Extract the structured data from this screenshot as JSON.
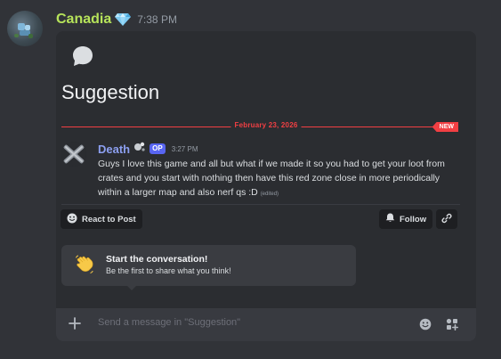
{
  "message": {
    "author": "Canadia",
    "timestamp": "7:38 PM",
    "badge_icon": "gem-icon",
    "author_color": "#b6e35a"
  },
  "thread": {
    "icon": "speech-bubble-icon",
    "title": "Suggestion",
    "divider_date": "February 23, 2026",
    "new_badge": "NEW",
    "accent": "#f23f43"
  },
  "post": {
    "author": "Death",
    "op_tag": "OP",
    "time": "3:27 PM",
    "body": "Guys I love this game and all but what if we made it so you had to get your loot from crates and you start with nothing then have this red zone close in more periodically within a larger map and also nerf qs :D",
    "edited": "(edited)"
  },
  "actions": {
    "react_label": "React to Post",
    "follow_label": "Follow"
  },
  "empty_state": {
    "icon": "waving-hand-icon",
    "title": "Start the conversation!",
    "subtitle": "Be the first to share what you think!"
  },
  "composer": {
    "placeholder": "Send a message in \"Suggestion\""
  }
}
